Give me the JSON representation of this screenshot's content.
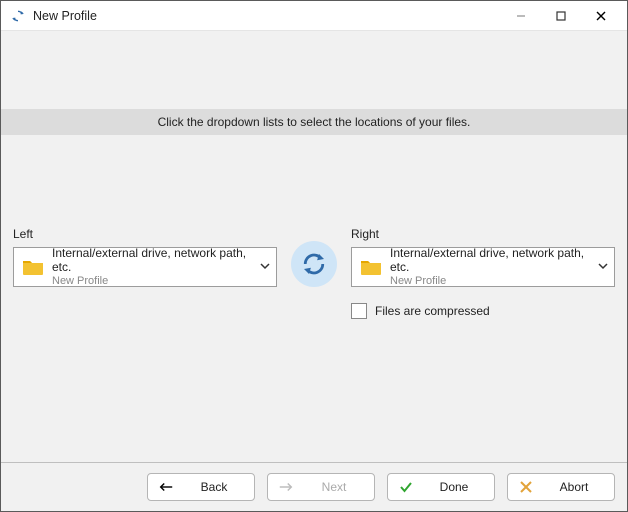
{
  "window": {
    "title": "New Profile"
  },
  "banner": "Click the dropdown lists to select the locations of your files.",
  "left": {
    "label": "Left",
    "dropdown_main": "Internal/external drive, network path, etc.",
    "dropdown_sub": "New Profile"
  },
  "right": {
    "label": "Right",
    "dropdown_main": "Internal/external drive, network path, etc.",
    "dropdown_sub": "New Profile",
    "compressed_label": "Files are compressed"
  },
  "buttons": {
    "back": "Back",
    "next": "Next",
    "done": "Done",
    "abort": "Abort"
  },
  "icons": {
    "app": "sync-app",
    "folder": "folder",
    "sync": "sync-arrows"
  },
  "colors": {
    "folder": "#f3c231",
    "folder_tab": "#e6a700",
    "sync_bg": "#cfe5f7",
    "sync_arrow": "#2f6aa8",
    "done": "#2fa52f",
    "abort": "#e2a33a"
  }
}
